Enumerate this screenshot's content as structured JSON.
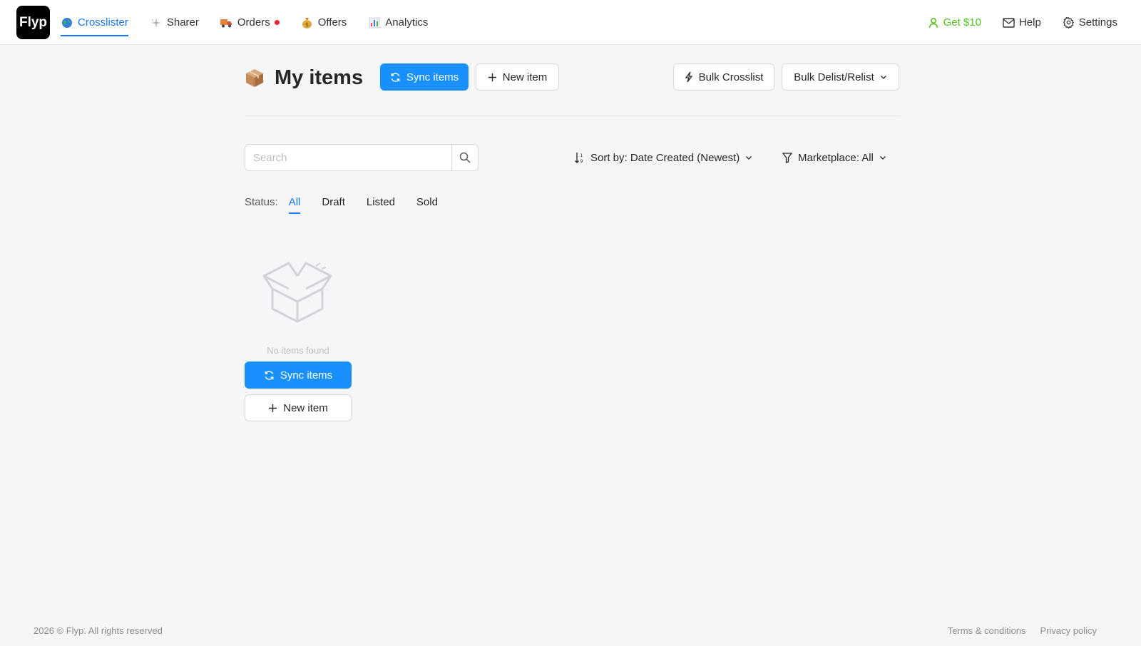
{
  "brand": {
    "logo_text": "Flyp"
  },
  "nav": {
    "items": [
      {
        "label": "Crosslister",
        "icon": "globe-icon"
      },
      {
        "label": "Sharer",
        "icon": "sparkle-icon"
      },
      {
        "label": "Orders",
        "icon": "truck-icon"
      },
      {
        "label": "Offers",
        "icon": "money-bag-icon"
      },
      {
        "label": "Analytics",
        "icon": "bar-chart-icon"
      }
    ],
    "active_index": 0,
    "orders_has_notification": true,
    "right": {
      "referral_label": "Get $10",
      "help_label": "Help",
      "settings_label": "Settings"
    }
  },
  "page": {
    "title": "My items",
    "title_icon": "package-icon",
    "sync_label": "Sync items",
    "new_item_label": "New item",
    "bulk_crosslist_label": "Bulk Crosslist",
    "bulk_delist_label": "Bulk Delist/Relist"
  },
  "filters": {
    "search_placeholder": "Search",
    "sort_label": "Sort by: Date Created (Newest)",
    "marketplace_label": "Marketplace: All",
    "status_label": "Status:",
    "status_tabs": [
      "All",
      "Draft",
      "Listed",
      "Sold"
    ],
    "active_status_index": 0
  },
  "empty_state": {
    "message": "No items found",
    "sync_label": "Sync items",
    "new_item_label": "New item"
  },
  "footer": {
    "copyright": "2026 © Flyp. All rights reserved",
    "terms": "Terms & conditions",
    "privacy": "Privacy policy"
  },
  "colors": {
    "primary": "#1890ff",
    "active_link": "#1677ff",
    "referral_green": "#52c41a",
    "notification_red": "#f5222d",
    "background": "#f5f6f8"
  }
}
